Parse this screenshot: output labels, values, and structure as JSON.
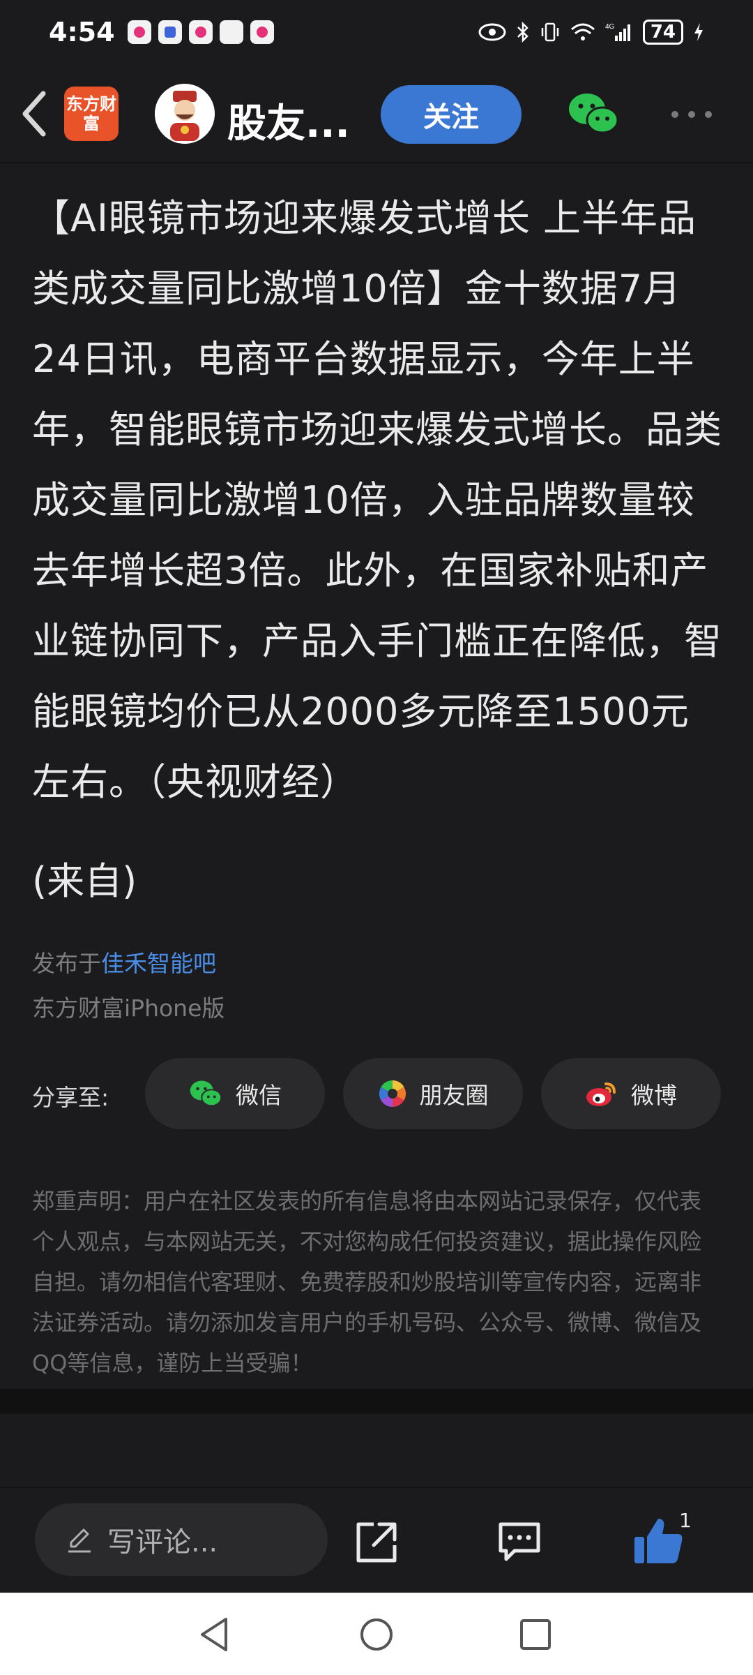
{
  "status_bar": {
    "time": "4:54",
    "battery": "74",
    "network": "4G"
  },
  "nav": {
    "app_logo_text": "东方财富",
    "username": "股友...",
    "follow_label": "关注"
  },
  "article": {
    "body": "【AI眼镜市场迎来爆发式增长 上半年品类成交量同比激增10倍】金十数据7月24日讯，电商平台数据显示，今年上半年，智能眼镜市场迎来爆发式增长。品类成交量同比激增10倍，入驻品牌数量较去年增长超3倍。此外，在国家补贴和产业链协同下，产品入手门槛正在降低，智能眼镜均价已从2000多元降至1500元左右。（央视财经）",
    "source": "(来自)",
    "published_prefix": "发布于",
    "board_name": "佳禾智能吧",
    "client": "东方财富iPhone版"
  },
  "share": {
    "label": "分享至:",
    "wechat": "微信",
    "moments": "朋友圈",
    "weibo": "微博"
  },
  "disclaimer": "郑重声明：用户在社区发表的所有信息将由本网站记录保存，仅代表个人观点，与本网站无关，不对您构成任何投资建议，据此操作风险自担。请勿相信代客理财、免费荐股和炒股培训等宣传内容，远离非法证券活动。请勿添加发言用户的手机号码、公众号、微博、微信及QQ等信息，谨防上当受骗！",
  "bottom_bar": {
    "comment_placeholder": "写评论...",
    "like_count": "1"
  },
  "colors": {
    "background": "#1b1b1d",
    "accent_blue": "#3a78d4",
    "link_blue": "#4a8de6",
    "wechat_green": "#2dc24f"
  }
}
